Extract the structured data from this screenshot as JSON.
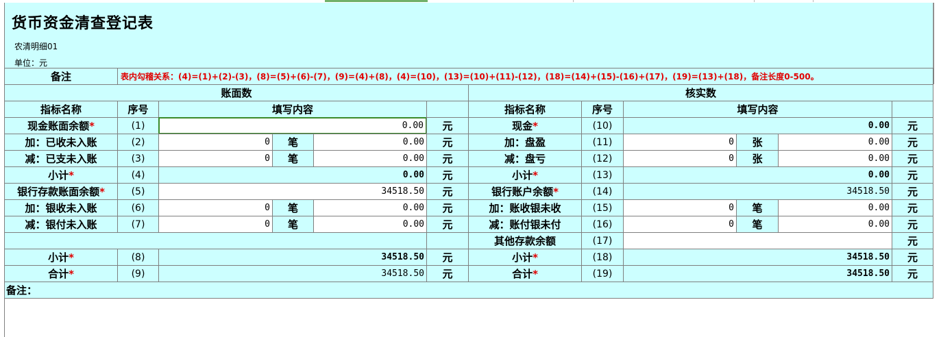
{
  "title": "货币资金清查登记表",
  "subtitle": "农清明细01",
  "unit_line": "单位：元",
  "note_label": "备注",
  "note_text": "表内勾稽关系：(4)=(1)+(2)-(3)，(8)=(5)+(6)-(7)，(9)=(4)+(8)，(4)=(10)，(13)=(10)+(11)-(12)，(18)=(14)+(15)-(16)+(17)，(19)=(13)+(18)，备注长度0-500。",
  "left_section": "账面数",
  "right_section": "核实数",
  "headers": {
    "name": "指标名称",
    "seq": "序号",
    "content": "填写内容"
  },
  "star": "*",
  "units": {
    "yuan": "元",
    "bi": "笔",
    "zhang": "张"
  },
  "left_rows": [
    {
      "label": "现金账面余额",
      "star": "*",
      "seq": "(1)",
      "value": "0.00"
    },
    {
      "label": "加：已收未入账",
      "star": "",
      "seq": "(2)",
      "count": "0",
      "value": "0.00"
    },
    {
      "label": "减：已支未入账",
      "star": "",
      "seq": "(3)",
      "count": "0",
      "value": "0.00"
    },
    {
      "label": "小计",
      "star": "*",
      "seq": "(4)",
      "value": "0.00"
    },
    {
      "label": "银行存款账面余额",
      "star": "*",
      "seq": "(5)",
      "value": "34518.50"
    },
    {
      "label": "加：银收未入账",
      "star": "",
      "seq": "(6)",
      "count": "0",
      "value": "0.00"
    },
    {
      "label": "减：银付未入账",
      "star": "",
      "seq": "(7)",
      "count": "0",
      "value": "0.00"
    },
    {
      "label": "小计",
      "star": "*",
      "seq": "(8)",
      "value": "34518.50"
    },
    {
      "label": "合计",
      "star": "*",
      "seq": "(9)",
      "value": "34518.50"
    }
  ],
  "right_rows": [
    {
      "label": "现金",
      "star": "*",
      "seq": "(10)",
      "value": "0.00"
    },
    {
      "label": "加：盘盈",
      "star": "",
      "seq": "(11)",
      "count": "0",
      "value": "0.00"
    },
    {
      "label": "减：盘亏",
      "star": "",
      "seq": "(12)",
      "count": "0",
      "value": "0.00"
    },
    {
      "label": "小计",
      "star": "*",
      "seq": "(13)",
      "value": "0.00"
    },
    {
      "label": "银行账户余额",
      "star": "*",
      "seq": "(14)",
      "value": "34518.50"
    },
    {
      "label": "加：账收银未收",
      "star": "",
      "seq": "(15)",
      "count": "0",
      "value": "0.00"
    },
    {
      "label": "减：账付银未付",
      "star": "",
      "seq": "(16)",
      "count": "0",
      "value": "0.00"
    },
    {
      "label": "其他存款余额",
      "star": "",
      "seq": "(17)",
      "value": ""
    },
    {
      "label": "小计",
      "star": "*",
      "seq": "(18)",
      "value": "34518.50"
    },
    {
      "label": "合计",
      "star": "*",
      "seq": "(19)",
      "value": "34518.50"
    }
  ],
  "remark_label": "备注：",
  "colors": {
    "cell_bg": "#ccffff",
    "grid": "#7f7f7f",
    "required": "#e00000",
    "selection": "#3a8a2a"
  }
}
